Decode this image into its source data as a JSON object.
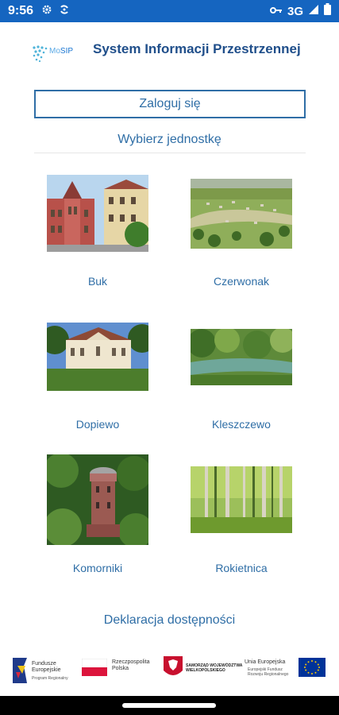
{
  "status": {
    "time": "9:56",
    "network": "3G",
    "icons": [
      "gear-icon",
      "sync-icon",
      "vpn-key-icon",
      "signal-icon",
      "battery-icon"
    ]
  },
  "header": {
    "logo_text_prefix": "Mo",
    "logo_text_suffix": "SIP",
    "title": "System Informacji Przestrzennej"
  },
  "login": {
    "label": "Zaloguj się"
  },
  "units_section": {
    "title": "Wybierz jednostkę"
  },
  "units": [
    {
      "name": "Buk",
      "image": "town-hall-photo"
    },
    {
      "name": "Czerwonak",
      "image": "aerial-village-photo"
    },
    {
      "name": "Dopiewo",
      "image": "manor-house-photo"
    },
    {
      "name": "Kleszczewo",
      "image": "park-pond-photo"
    },
    {
      "name": "Komorniki",
      "image": "water-tower-photo"
    },
    {
      "name": "Rokietnica",
      "image": "forest-photo"
    }
  ],
  "footer": {
    "accessibility_label": "Deklaracja dostępności",
    "funding": {
      "fe_line1": "Fundusze",
      "fe_line2": "Europejskie",
      "fe_line3": "Program Regionalny",
      "rp_line1": "Rzeczpospolita",
      "rp_line2": "Polska",
      "wlkp_line1": "SAMORZĄD WOJEWÓDZTWA",
      "wlkp_line2": "WIELKOPOLSKIEGO",
      "eu_line1": "Unia Europejska",
      "eu_line2": "Europejski Fundusz",
      "eu_line3": "Rozwoju Regionalnego"
    }
  },
  "colors": {
    "status_bar": "#1565c0",
    "accent": "#2f6ea6",
    "title": "#1f4e8a"
  }
}
